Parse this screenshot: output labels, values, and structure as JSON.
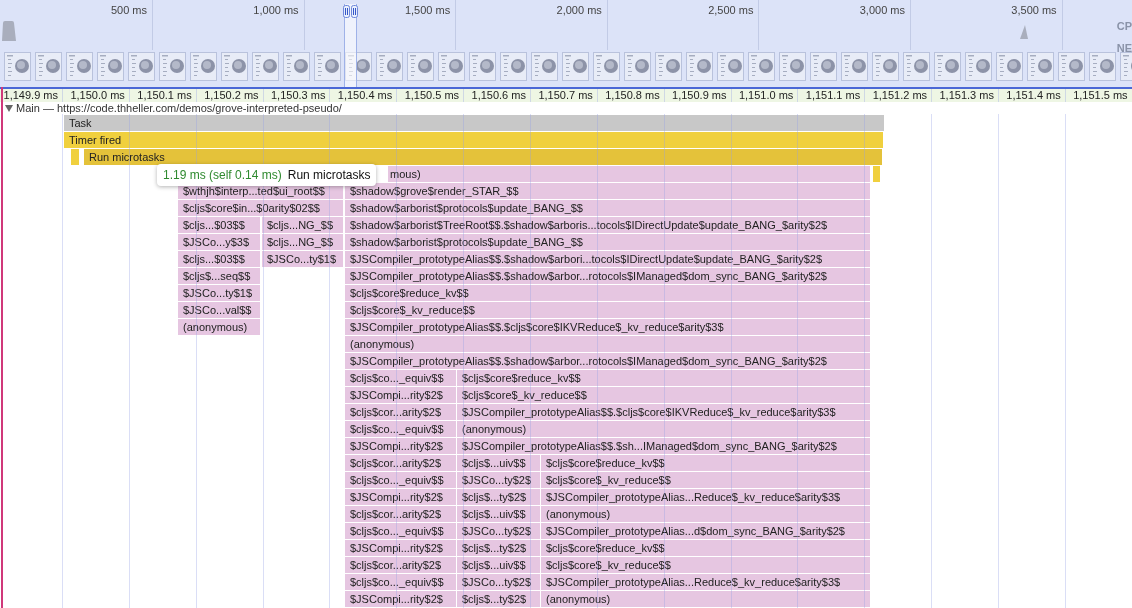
{
  "overview": {
    "ticks": [
      "500 ms",
      "1,000 ms",
      "1,500 ms",
      "2,000 ms",
      "2,500 ms",
      "3,000 ms",
      "3,500 ms"
    ],
    "tracks": [
      "CP",
      "NE"
    ]
  },
  "ruler": {
    "ticks": [
      "1,149.9 ms",
      "1,150.0 ms",
      "1,150.1 ms",
      "1,150.2 ms",
      "1,150.3 ms",
      "1,150.4 ms",
      "1,150.5 ms",
      "1,150.6 ms",
      "1,150.7 ms",
      "1,150.8 ms",
      "1,150.9 ms",
      "1,151.0 ms",
      "1,151.1 ms",
      "1,151.2 ms",
      "1,151.3 ms",
      "1,151.4 ms",
      "1,151.5 ms"
    ]
  },
  "track": {
    "title": "Main — https://code.thheller.com/demos/grove-interpreted-pseudo/",
    "expanded": true
  },
  "flame": {
    "rows": [
      [
        {
          "kind": "task",
          "label": "Task"
        }
      ],
      [
        {
          "kind": "timer",
          "label": "Timer fired"
        }
      ],
      [
        {
          "kind": "marker"
        },
        {
          "kind": "microtask",
          "label": "Run microtasks"
        }
      ],
      [
        {
          "kind": "script",
          "label": "mous)"
        },
        {
          "kind": "marker"
        }
      ],
      [
        {
          "kind": "script",
          "label": "$wthjh$interp...ted$ui_root$$"
        },
        {
          "kind": "script",
          "label": "$shadow$grove$render_STAR_$$"
        }
      ],
      [
        {
          "kind": "script",
          "label": "$cljs$core$in...$0arity$02$$"
        },
        {
          "kind": "script",
          "label": "$shadow$arborist$protocols$update_BANG_$$"
        }
      ],
      [
        {
          "kind": "script",
          "label": "$cljs...$03$$"
        },
        {
          "kind": "script",
          "label": "$cljs...NG_$$"
        },
        {
          "kind": "script",
          "label": "$shadow$arborist$TreeRoot$$.$shadow$arboris...tocols$IDirectUpdate$update_BANG_$arity$2$"
        }
      ],
      [
        {
          "kind": "script",
          "label": "$JSCo...y$3$"
        },
        {
          "kind": "script",
          "label": "$cljs...NG_$$"
        },
        {
          "kind": "script",
          "label": "$shadow$arborist$protocols$update_BANG_$$"
        }
      ],
      [
        {
          "kind": "script",
          "label": "$cljs...$03$$"
        },
        {
          "kind": "script",
          "label": "$JSCo...ty$1$"
        },
        {
          "kind": "script",
          "label": "$JSCompiler_prototypeAlias$$.$shadow$arbori...tocols$IDirectUpdate$update_BANG_$arity$2$"
        }
      ],
      [
        {
          "kind": "script",
          "label": "$cljs$...seq$$"
        },
        {
          "kind": "script",
          "label": "$JSCompiler_prototypeAlias$$.$shadow$arbor...rotocols$IManaged$dom_sync_BANG_$arity$2$"
        }
      ],
      [
        {
          "kind": "script",
          "label": "$JSCo...ty$1$"
        },
        {
          "kind": "script",
          "label": "$cljs$core$reduce_kv$$"
        }
      ],
      [
        {
          "kind": "script",
          "label": "$JSCo...val$$"
        },
        {
          "kind": "script",
          "label": "$cljs$core$_kv_reduce$$"
        }
      ],
      [
        {
          "kind": "script",
          "label": "(anonymous)"
        },
        {
          "kind": "script",
          "label": "$JSCompiler_prototypeAlias$$.$cljs$core$IKVReduce$_kv_reduce$arity$3$"
        }
      ],
      [
        {
          "kind": "script",
          "label": "(anonymous)"
        }
      ],
      [
        {
          "kind": "script",
          "label": "$JSCompiler_prototypeAlias$$.$shadow$arbor...rotocols$IManaged$dom_sync_BANG_$arity$2$"
        }
      ],
      [
        {
          "kind": "script",
          "label": "$cljs$co..._equiv$$"
        },
        {
          "kind": "script",
          "label": "$cljs$core$reduce_kv$$"
        }
      ],
      [
        {
          "kind": "script",
          "label": "$JSCompi...rity$2$"
        },
        {
          "kind": "script",
          "label": "$cljs$core$_kv_reduce$$"
        }
      ],
      [
        {
          "kind": "script",
          "label": "$cljs$cor...arity$2$"
        },
        {
          "kind": "script",
          "label": "$JSCompiler_prototypeAlias$$.$cljs$core$IKVReduce$_kv_reduce$arity$3$"
        }
      ],
      [
        {
          "kind": "script",
          "label": "$cljs$co..._equiv$$"
        },
        {
          "kind": "script",
          "label": "(anonymous)"
        }
      ],
      [
        {
          "kind": "script",
          "label": "$JSCompi...rity$2$"
        },
        {
          "kind": "script",
          "label": "$JSCompiler_prototypeAlias$$.$sh...IManaged$dom_sync_BANG_$arity$2$"
        }
      ],
      [
        {
          "kind": "script",
          "label": "$cljs$cor...arity$2$"
        },
        {
          "kind": "script",
          "label": "$cljs$...uiv$$"
        },
        {
          "kind": "script",
          "label": "$cljs$core$reduce_kv$$"
        }
      ],
      [
        {
          "kind": "script",
          "label": "$cljs$co..._equiv$$"
        },
        {
          "kind": "script",
          "label": "$JSCo...ty$2$"
        },
        {
          "kind": "script",
          "label": "$cljs$core$_kv_reduce$$"
        }
      ],
      [
        {
          "kind": "script",
          "label": "$JSCompi...rity$2$"
        },
        {
          "kind": "script",
          "label": "$cljs$...ty$2$"
        },
        {
          "kind": "script",
          "label": "$JSCompiler_prototypeAlias...Reduce$_kv_reduce$arity$3$"
        }
      ],
      [
        {
          "kind": "script",
          "label": "$cljs$cor...arity$2$"
        },
        {
          "kind": "script",
          "label": "$cljs$...uiv$$"
        },
        {
          "kind": "script",
          "label": "(anonymous)"
        }
      ],
      [
        {
          "kind": "script",
          "label": "$cljs$co..._equiv$$"
        },
        {
          "kind": "script",
          "label": "$JSCo...ty$2$"
        },
        {
          "kind": "script",
          "label": "$JSCompiler_prototypeAlias...d$dom_sync_BANG_$arity$2$"
        }
      ],
      [
        {
          "kind": "script",
          "label": "$JSCompi...rity$2$"
        },
        {
          "kind": "script",
          "label": "$cljs$...ty$2$"
        },
        {
          "kind": "script",
          "label": "$cljs$core$reduce_kv$$"
        }
      ],
      [
        {
          "kind": "script",
          "label": "$cljs$cor...arity$2$"
        },
        {
          "kind": "script",
          "label": "$cljs$...uiv$$"
        },
        {
          "kind": "script",
          "label": "$cljs$core$_kv_reduce$$"
        }
      ],
      [
        {
          "kind": "script",
          "label": "$cljs$co..._equiv$$"
        },
        {
          "kind": "script",
          "label": "$JSCo...ty$2$"
        },
        {
          "kind": "script",
          "label": "$JSCompiler_prototypeAlias...Reduce$_kv_reduce$arity$3$"
        }
      ],
      [
        {
          "kind": "script",
          "label": "$JSCompi...rity$2$"
        },
        {
          "kind": "script",
          "label": "$cljs$...ty$2$"
        },
        {
          "kind": "script",
          "label": "(anonymous)"
        }
      ]
    ]
  },
  "tooltip": {
    "duration": "1.19 ms (self 0.14 ms)",
    "name": "Run microtasks"
  }
}
